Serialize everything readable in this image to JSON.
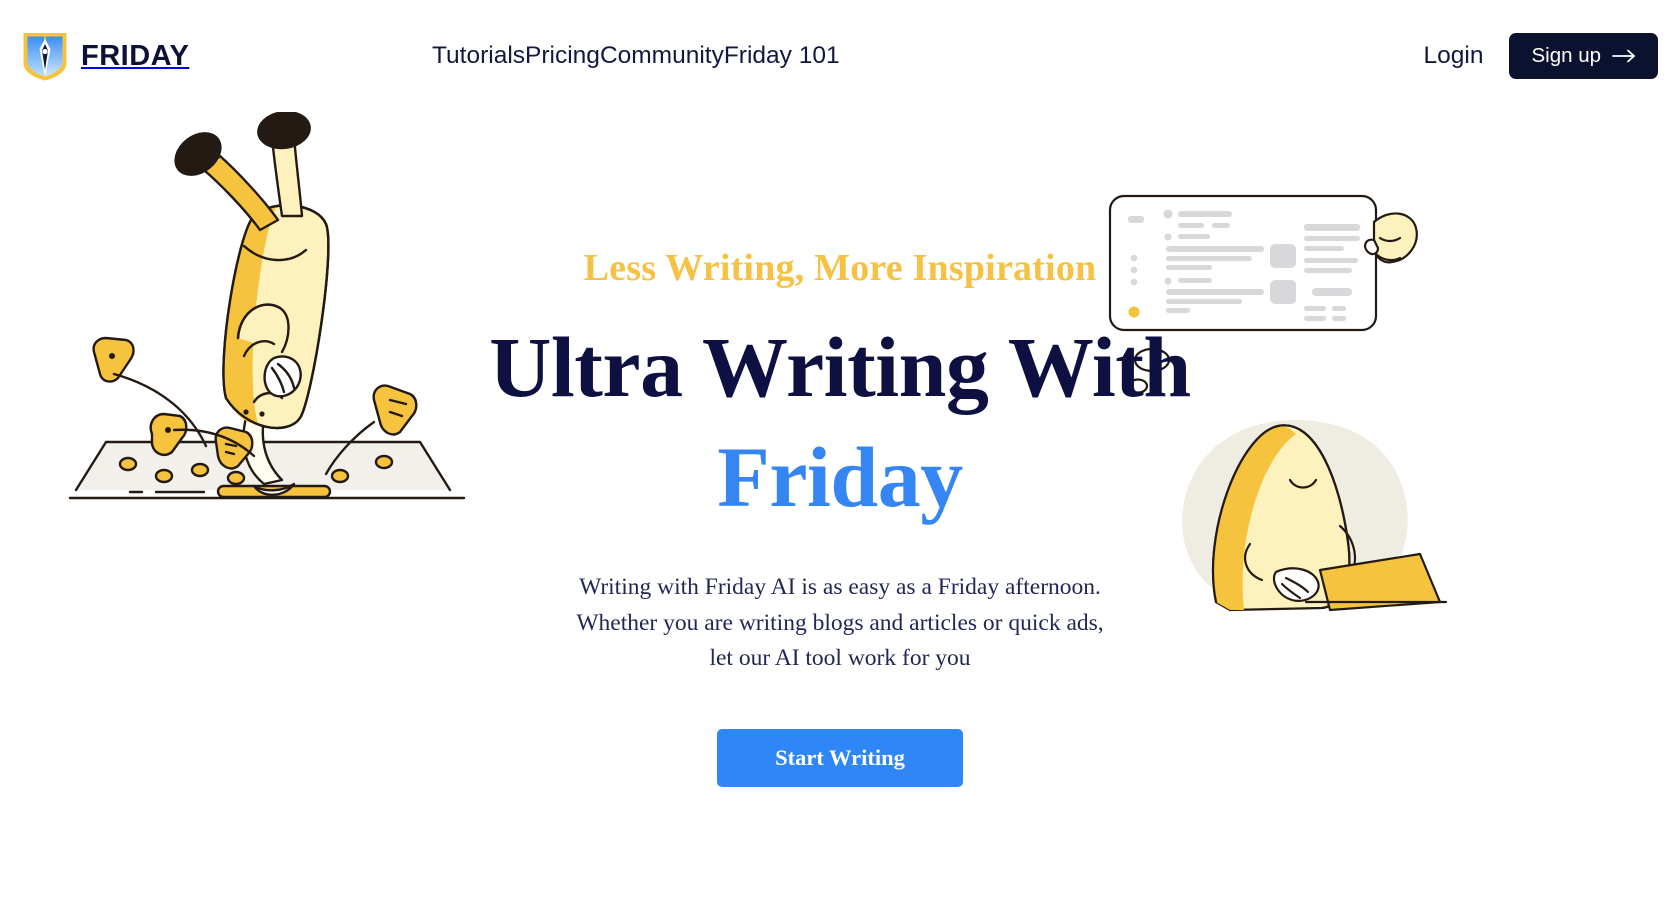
{
  "brand": {
    "name": "FRIDAY",
    "logo_icon": "book-pen-logo-icon",
    "logo_colors": {
      "outer": "#f6c33f",
      "pages": "#3b8ef5",
      "nib": "#0d1040"
    }
  },
  "nav": {
    "links": [
      {
        "label": "Tutorials",
        "name": "nav-link-tutorials"
      },
      {
        "label": "Pricing",
        "name": "nav-link-pricing"
      },
      {
        "label": "Community",
        "name": "nav-link-community"
      },
      {
        "label": "Friday 101",
        "name": "nav-link-friday-101"
      }
    ],
    "login_label": "Login",
    "signup_label": "Sign up",
    "signup_icon": "arrow-right-icon"
  },
  "hero": {
    "eyebrow": "Less Writing, More Inspiration",
    "headline_line1": "Ultra Writing With",
    "headline_accent": "Friday",
    "subtitle_line1": "Writing with Friday AI is as easy as a Friday afternoon.",
    "subtitle_line2": "Whether you are writing blogs and articles or quick ads,",
    "subtitle_line3": "let our AI tool work for you",
    "cta_label": "Start Writing"
  },
  "illustrations": {
    "left": {
      "name": "handstand-character-on-keyboard-illustration",
      "description": "Yellow character doing a handstand on a keyboard with letter keys A, F, R flying off"
    },
    "right": {
      "name": "character-with-laptop-thinking-illustration",
      "description": "Yellow blob character with laptop and thought bubble showing a document layout on a tablet"
    }
  },
  "colors": {
    "brand_navy": "#0d1040",
    "accent_blue": "#2f86f6",
    "accent_yellow": "#f5c243",
    "signup_bg": "#0b1230",
    "page_bg": "#ffffff"
  }
}
